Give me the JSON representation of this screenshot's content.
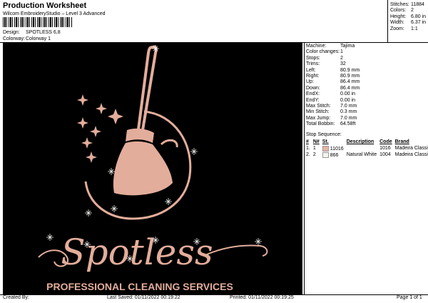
{
  "header": {
    "title": "Production Worksheet",
    "software": "Wilcom EmbroideryStudio – Level 3 Advanced",
    "design_label": "Design:",
    "design_value": "SPOTLESS 6,8",
    "colorway_label": "Colorway:",
    "colorway_value": "Colorway 1"
  },
  "summary": [
    {
      "label": "Stitches:",
      "value": "11884"
    },
    {
      "label": "Colors:",
      "value": "2"
    },
    {
      "label": "Height:",
      "value": "6.80 in"
    },
    {
      "label": "Width:",
      "value": "6.37 in"
    },
    {
      "label": "Zoom:",
      "value": "1:1"
    }
  ],
  "machine_info": [
    {
      "label": "Machine:",
      "value": "Tajima"
    },
    {
      "label": "Color changes:",
      "value": "1"
    },
    {
      "label": "Stops:",
      "value": "2"
    },
    {
      "label": "Trims:",
      "value": "32"
    },
    {
      "label": "Left:",
      "value": "80.9 mm"
    },
    {
      "label": "Right:",
      "value": "80.9 mm"
    },
    {
      "label": "Up:",
      "value": "86.4 mm"
    },
    {
      "label": "Down:",
      "value": "86.4 mm"
    },
    {
      "label": "EndX:",
      "value": "0.00 in"
    },
    {
      "label": "EndY:",
      "value": "0.00 in"
    },
    {
      "label": "Max Stitch:",
      "value": "7.0 mm"
    },
    {
      "label": "Min Stitch:",
      "value": "0.3 mm"
    },
    {
      "label": "Max Jump:",
      "value": "7.0 mm"
    },
    {
      "label": "Total Bobbin:",
      "value": "64.58ft"
    }
  ],
  "stop_sequence": {
    "title": "Stop Sequence:",
    "headers": [
      "#",
      "N#",
      "St.",
      "Description",
      "Code",
      "Brand"
    ],
    "rows": [
      {
        "num": "1.",
        "n": "1",
        "st": "11016",
        "desc": "",
        "code": "1016",
        "brand": "Madeira Classic 40",
        "color": "#e8b4a4"
      },
      {
        "num": "2.",
        "n": "2",
        "st": "866",
        "desc": "Natural White",
        "code": "1004",
        "brand": "Madeira Classic 40",
        "color": "#f4f4f0"
      }
    ]
  },
  "design": {
    "name": "Spotless",
    "tagline": "PROFESSIONAL CLEANING SERVICES",
    "thread_color": "#e3ad9b",
    "sparkle_color": "#f4f4f0"
  },
  "footer": {
    "created": "Created By:",
    "last_saved": "Last Saved: 01/11/2022 00:19:22",
    "printed": "Printed: 01/11/2022 00:19:25",
    "page": "Page 1 of 1"
  }
}
